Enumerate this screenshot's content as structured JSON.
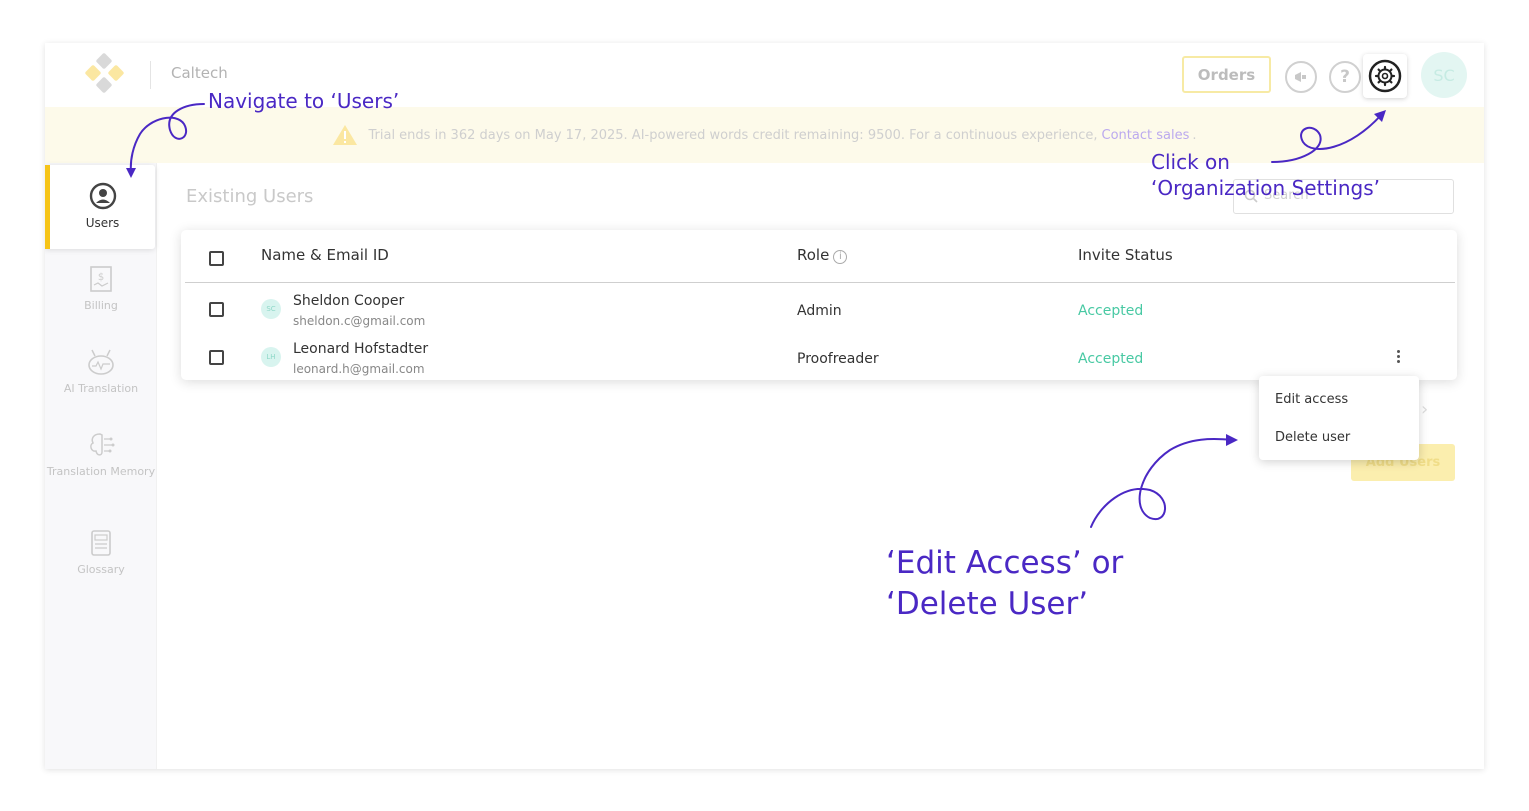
{
  "header": {
    "org_name": "Caltech",
    "orders_label": "Orders",
    "help_symbol": "?",
    "avatar_initials": "SC"
  },
  "banner": {
    "text": "Trial ends in 362 days on May 17, 2025. AI-powered words credit remaining: 9500. For a continuous experience,",
    "link": "Contact sales",
    "suffix": "."
  },
  "sidebar": {
    "items": [
      {
        "label": "Users",
        "icon": "user-circle-icon",
        "active": true
      },
      {
        "label": "Billing",
        "icon": "receipt-icon"
      },
      {
        "label": "AI Translation",
        "icon": "robot-icon"
      },
      {
        "label": "Translation Memory",
        "icon": "brain-icon"
      },
      {
        "label": "Glossary",
        "icon": "book-icon"
      }
    ]
  },
  "main": {
    "title": "Existing Users",
    "search_placeholder": "Search",
    "columns": [
      "Name & Email ID",
      "Role",
      "Invite Status"
    ],
    "rows": [
      {
        "initials": "SC",
        "name": "Sheldon Cooper",
        "email": "sheldon.c@gmail.com",
        "role": "Admin",
        "status": "Accepted"
      },
      {
        "initials": "LH",
        "name": "Leonard Hofstadter",
        "email": "leonard.h@gmail.com",
        "role": "Proofreader",
        "status": "Accepted"
      }
    ],
    "menu": [
      "Edit access",
      "Delete user"
    ],
    "add_users_label": "Add Users"
  },
  "annotations": {
    "users": "Navigate to ‘Users’",
    "org_line1": "Click on",
    "org_line2": "‘Organization Settings’",
    "edit_line1": "‘Edit Access’ or",
    "edit_line2": "‘Delete User’"
  },
  "colors": {
    "accent_yellow": "#f6c417",
    "status_green": "#48c9a3",
    "annotation_purple": "#4a28c4",
    "banner_bg": "#fdfaea"
  }
}
